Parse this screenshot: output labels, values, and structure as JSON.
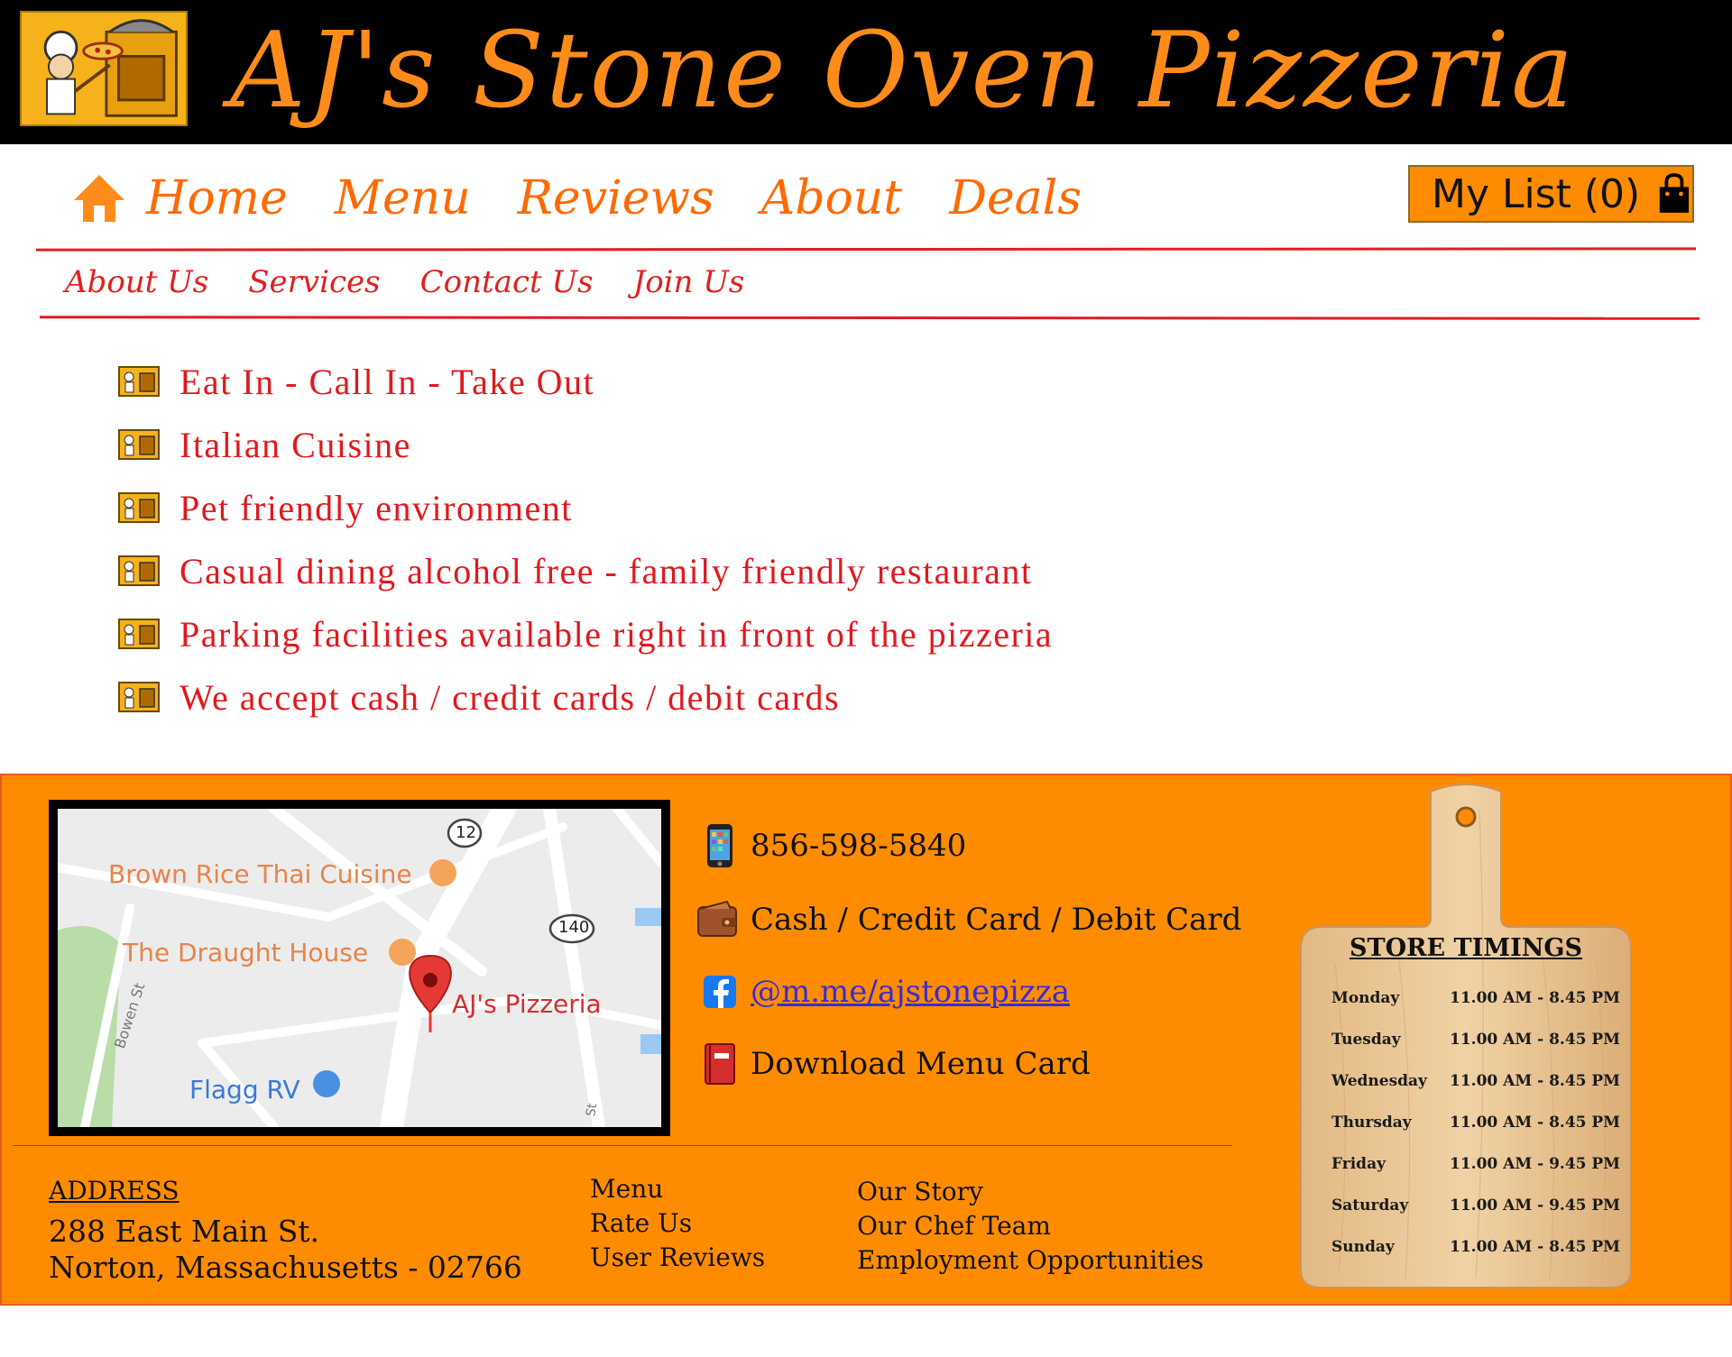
{
  "header": {
    "title": "AJ's Stone Oven Pizzeria",
    "logo_icon": "chef-pizza-oven-logo"
  },
  "nav": {
    "home": "Home",
    "menu": "Menu",
    "reviews": "Reviews",
    "about": "About",
    "deals": "Deals"
  },
  "mylist": {
    "label": "My List (0)",
    "icon": "shopping-bag-icon"
  },
  "subnav": {
    "about_us": "About Us",
    "services": "Services",
    "contact_us": "Contact Us",
    "join_us": "Join Us"
  },
  "features": [
    "Eat In - Call In - Take Out",
    "Italian Cuisine",
    "Pet friendly environment",
    "Casual dining alcohol free - family friendly restaurant",
    "Parking facilities available right in front of the pizzeria",
    "We accept cash / credit cards / debit cards"
  ],
  "map": {
    "labels": {
      "brown_rice": "Brown Rice Thai Cuisine",
      "draught": "The Draught House",
      "ajs": "AJ's Pizzeria",
      "flagg": "Flagg RV",
      "bowen": "Bowen St",
      "route12": "12",
      "route140": "140",
      "st": "St"
    }
  },
  "contact": {
    "phone": "856-598-5840",
    "payment": "Cash / Credit Card / Debit Card",
    "facebook": "@m.me/ajstonepizza",
    "download": "Download Menu Card"
  },
  "address": {
    "heading": "ADDRESS",
    "line1": "288 East Main St.",
    "line2": "Norton, Massachusetts - 02766"
  },
  "footer_links": {
    "col1": [
      "Menu",
      "Rate Us",
      "User Reviews"
    ],
    "col2": [
      "Our Story",
      "Our Chef Team",
      "Employment Opportunities"
    ]
  },
  "store_timings": {
    "title": "STORE TIMINGS",
    "rows": [
      {
        "day": "Monday",
        "hours": "11.00 AM - 8.45 PM"
      },
      {
        "day": "Tuesday",
        "hours": "11.00 AM - 8.45 PM"
      },
      {
        "day": "Wednesday",
        "hours": "11.00 AM - 8.45 PM"
      },
      {
        "day": "Thursday",
        "hours": "11.00 AM - 8.45 PM"
      },
      {
        "day": "Friday",
        "hours": "11.00 AM - 9.45 PM"
      },
      {
        "day": "Saturday",
        "hours": "11.00 AM - 9.45 PM"
      },
      {
        "day": "Sunday",
        "hours": "11.00 AM - 8.45 PM"
      }
    ]
  },
  "colors": {
    "header_bg": "#000000",
    "title": "#ff8c1a",
    "nav": "#ff6a00",
    "accent_red": "#e31b23",
    "footer_bg": "#ff8c00"
  }
}
